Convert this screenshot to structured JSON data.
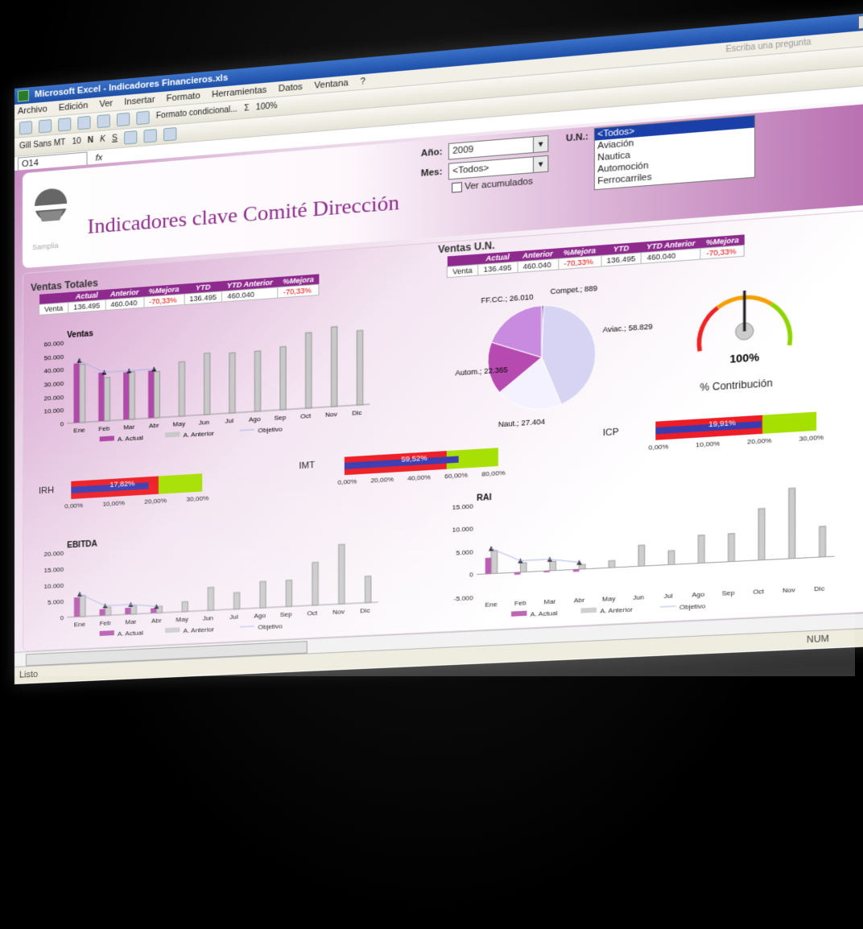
{
  "window": {
    "title": "Microsoft Excel - Indicadores Financieros.xls",
    "buttons": [
      "_",
      "□",
      "X"
    ]
  },
  "menu": {
    "items": [
      "Archivo",
      "Edición",
      "Ver",
      "Insertar",
      "Formato",
      "Herramientas",
      "Datos",
      "Ventana",
      "?"
    ],
    "ask_placeholder": "Escriba una pregunta"
  },
  "toolbar": {
    "conditional_format": "Formato condicional...",
    "zoom": "100%",
    "font": "Gill Sans MT",
    "size": "10",
    "bold": "N",
    "italic": "K",
    "underline": "S"
  },
  "formula": {
    "cell": "O14",
    "fx": "fx"
  },
  "filters": {
    "year_label": "Año:",
    "year_value": "2009",
    "month_label": "Mes:",
    "month_value": "<Todos>",
    "accumulated": "Ver acumulados",
    "un_label": "U.N.:",
    "un_options": [
      "<Todos>",
      "Aviación",
      "Nautica",
      "Automoción",
      "Ferrocarriles"
    ]
  },
  "logo_text": "Samplia",
  "page_title": "Indicadores clave Comité Dirección",
  "ventas_totales": {
    "title": "Ventas Totales",
    "headers": [
      "",
      "Actual",
      "Anterior",
      "%Mejora",
      "YTD",
      "YTD Anterior",
      "%Mejora"
    ],
    "row": [
      "Venta",
      "136.495",
      "460.040",
      "-70,33%",
      "136.495",
      "460.040",
      "-70,33%"
    ]
  },
  "ventas_un": {
    "title": "Ventas U.N.",
    "headers": [
      "",
      "Actual",
      "Anterior",
      "%Mejora",
      "YTD",
      "YTD Anterior",
      "%Mejora"
    ],
    "row": [
      "Venta",
      "136.495",
      "460.040",
      "-70,33%",
      "136.495",
      "460.040",
      "-70,33%"
    ]
  },
  "gauge": {
    "value": "100%",
    "label": "% Contribución",
    "ticks": [
      "20",
      "40",
      "60",
      "80",
      "100",
      "120",
      "140",
      "160",
      "180",
      "200"
    ]
  },
  "kpi_bars": [
    {
      "name": "IRH",
      "value": "17,82%",
      "ticks": [
        "0,00%",
        "10,00%",
        "20,00%",
        "30,00%"
      ]
    },
    {
      "name": "IMT",
      "value": "59,52%",
      "ticks": [
        "0,00%",
        "20,00%",
        "40,00%",
        "60,00%",
        "80,00%"
      ]
    },
    {
      "name": "ICP",
      "value": "19,91%",
      "ticks": [
        "0,00%",
        "10,00%",
        "20,00%",
        "30,00%"
      ]
    }
  ],
  "legend": {
    "actual": "A. Actual",
    "anterior": "A. Anterior",
    "objetivo": "Objetivo"
  },
  "status": {
    "left": "Listo",
    "right": "NUM"
  },
  "chart_data": [
    {
      "type": "bar",
      "title": "Ventas",
      "categories": [
        "Ene",
        "Feb",
        "Mar",
        "Abr",
        "May",
        "Jun",
        "Jul",
        "Ago",
        "Sep",
        "Oct",
        "Nov",
        "Dic"
      ],
      "series": [
        {
          "name": "A. Actual",
          "values": [
            44000,
            36000,
            35000,
            35000,
            null,
            null,
            null,
            null,
            null,
            null,
            null,
            null
          ]
        },
        {
          "name": "A. Anterior",
          "values": [
            43000,
            32000,
            35000,
            34000,
            40000,
            45000,
            44000,
            44000,
            46000,
            55000,
            58000,
            54000
          ]
        },
        {
          "name": "Objetivo",
          "values": [
            46000,
            36000,
            36000,
            36000,
            null,
            null,
            null,
            null,
            null,
            null,
            null,
            null
          ]
        }
      ],
      "ylim": [
        0,
        60000
      ],
      "yticks": [
        "60.000",
        "50.000",
        "40.000",
        "30.000",
        "20.000",
        "10.000",
        "0"
      ]
    },
    {
      "type": "pie",
      "slices": [
        {
          "label": "Compet.",
          "value": 889
        },
        {
          "label": "Aviac.",
          "value": 58829
        },
        {
          "label": "Naut.",
          "value": 27404
        },
        {
          "label": "Autom.",
          "value": 22365
        },
        {
          "label": "FF.CC.",
          "value": 26010
        }
      ],
      "labels": [
        "Compet.; 889",
        "Aviac.; 58.829",
        "Naut.; 27.404",
        "Autom.; 22.365",
        "FF.CC.; 26.010"
      ]
    },
    {
      "type": "bar",
      "title": "EBITDA",
      "categories": [
        "Ene",
        "Feb",
        "Mar",
        "Abr",
        "May",
        "Jun",
        "Jul",
        "Ago",
        "Sep",
        "Oct",
        "Nov",
        "Dic"
      ],
      "series": [
        {
          "name": "A. Actual",
          "values": [
            6000,
            2000,
            2000,
            1500,
            null,
            null,
            null,
            null,
            null,
            null,
            null,
            null
          ]
        },
        {
          "name": "A. Anterior",
          "values": [
            6500,
            2500,
            2500,
            2000,
            3000,
            7000,
            5000,
            8000,
            8000,
            13000,
            18000,
            8000
          ]
        },
        {
          "name": "Objetivo",
          "values": [
            7000,
            3000,
            3000,
            2000,
            null,
            null,
            null,
            null,
            null,
            null,
            null,
            null
          ]
        }
      ],
      "ylim": [
        0,
        20000
      ],
      "yticks": [
        "20.000",
        "15.000",
        "10.000",
        "5.000",
        "0"
      ]
    },
    {
      "type": "bar",
      "title": "RAI",
      "categories": [
        "Ene",
        "Feb",
        "Mar",
        "Abr",
        "May",
        "Jun",
        "Jul",
        "Ago",
        "Sep",
        "Oct",
        "Nov",
        "Dic"
      ],
      "series": [
        {
          "name": "A. Actual",
          "values": [
            3500,
            -500,
            -300,
            -500,
            null,
            null,
            null,
            null,
            null,
            null,
            null,
            null
          ]
        },
        {
          "name": "A. Anterior",
          "values": [
            5000,
            2000,
            2000,
            1000,
            1500,
            4500,
            3000,
            6000,
            6000,
            11000,
            15000,
            6500
          ]
        },
        {
          "name": "Objetivo",
          "values": [
            5500,
            2500,
            2500,
            1500,
            null,
            null,
            null,
            null,
            null,
            null,
            null,
            null
          ]
        }
      ],
      "ylim": [
        -5000,
        15000
      ],
      "yticks": [
        "15.000",
        "10.000",
        "5.000",
        "0",
        "-5.000"
      ]
    }
  ]
}
